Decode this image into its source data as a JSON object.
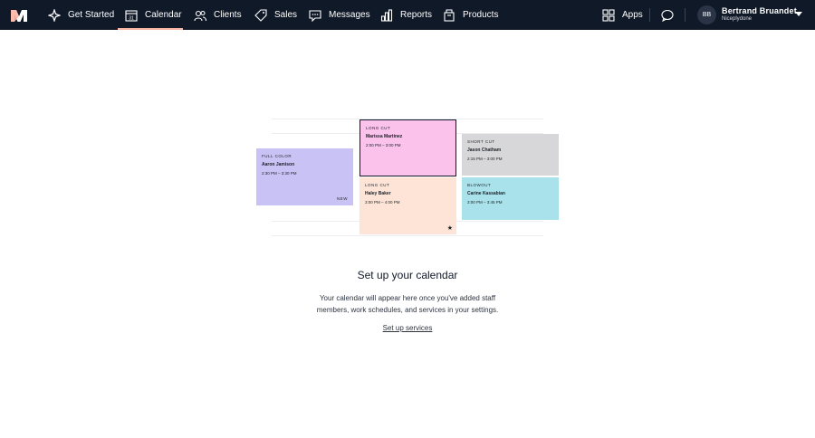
{
  "nav": {
    "items": [
      {
        "label": "Get Started",
        "icon": "sparkle-icon"
      },
      {
        "label": "Calendar",
        "icon": "calendar-icon",
        "icon_text": "31",
        "active": true
      },
      {
        "label": "Clients",
        "icon": "clients-icon"
      },
      {
        "label": "Sales",
        "icon": "tag-icon"
      },
      {
        "label": "Messages",
        "icon": "chat-bubble-icon"
      },
      {
        "label": "Reports",
        "icon": "bar-chart-icon"
      },
      {
        "label": "Products",
        "icon": "box-icon"
      }
    ],
    "apps_label": "Apps",
    "user": {
      "initials": "BB",
      "name": "Bertrand Bruandet",
      "business": "Niceplydone"
    },
    "accent_color": "#f9b5a4",
    "bar_color": "#101928"
  },
  "illustration": {
    "cards": [
      {
        "type": "FULL COLOR",
        "name": "Aaron Jamison",
        "time": "2:30 PM – 3:30 PM",
        "badge": "NEW",
        "color": "#c9c3f5"
      },
      {
        "type": "LONG CUT",
        "name": "Marissa Martinez",
        "time": "2:00 PM – 3:00 PM",
        "color": "#fbc3ec"
      },
      {
        "type": "LONG CUT",
        "name": "Haley Baker",
        "time": "3:00 PM – 4:00 PM",
        "color": "#fde4d6"
      },
      {
        "type": "SHORT CUT",
        "name": "Jason Chatham",
        "time": "2:15 PM – 3:00 PM",
        "color": "#d7d7d9"
      },
      {
        "type": "BLOWOUT",
        "name": "Carine Kassabian",
        "time": "3:00 PM – 3:45 PM",
        "color": "#a9e2ea"
      }
    ]
  },
  "empty_state": {
    "title": "Set up your calendar",
    "description": "Your calendar will appear here once you've added staff members, work schedules, and services in your settings.",
    "link": "Set up services"
  }
}
